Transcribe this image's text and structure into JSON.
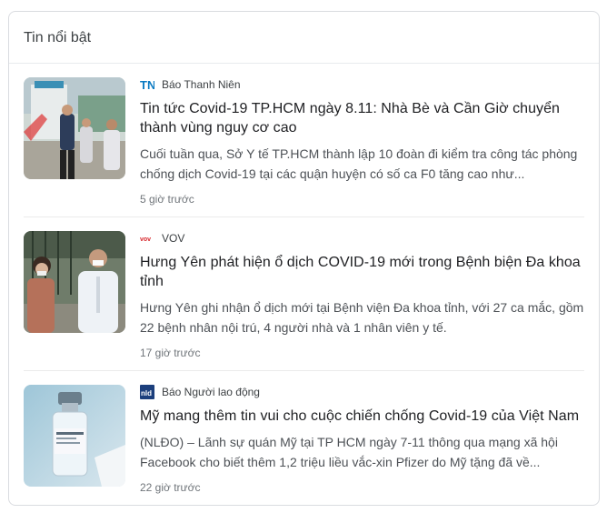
{
  "panel": {
    "title": "Tin nổi bật"
  },
  "colors": {
    "border": "#dadce0",
    "headline": "#202124",
    "snippet": "#4d5156",
    "meta": "#70757a"
  },
  "articles": [
    {
      "source": "Báo Thanh Niên",
      "logo_icon": "thanh-nien-logo",
      "headline": "Tin tức Covid-19 TP.HCM ngày 8.11: Nhà Bè và Cần Giờ chuyển thành vùng nguy cơ cao",
      "snippet": "Cuối tuần qua, Sở Y tế TP.HCM thành lập 10 đoàn đi kiểm tra công tác phòng chống dịch Covid-19 tại các quận huyện có số ca F0 tăng cao như...",
      "time": "5 giờ trước"
    },
    {
      "source": "VOV",
      "logo_icon": "vov-logo",
      "headline": "Hưng Yên phát hiện ổ dịch COVID-19 mới trong Bệnh biện Đa khoa tỉnh",
      "snippet": "Hưng Yên ghi nhận ổ dịch mới tại Bệnh viện Đa khoa tỉnh, với 27 ca mắc, gồm 22 bệnh nhân nội trú, 4 người nhà và 1 nhân viên y tế.",
      "time": "17 giờ trước"
    },
    {
      "source": "Báo Người lao động",
      "logo_icon": "nld-logo",
      "headline": "Mỹ mang thêm tin vui cho cuộc chiến chống Covid-19 của Việt Nam",
      "snippet": "(NLĐO) – Lãnh sự quán Mỹ tại TP HCM ngày 7-11 thông qua mạng xã hội Facebook cho biết thêm 1,2 triệu liều vắc-xin Pfizer do Mỹ tặng đã về...",
      "time": "22 giờ trước"
    }
  ]
}
